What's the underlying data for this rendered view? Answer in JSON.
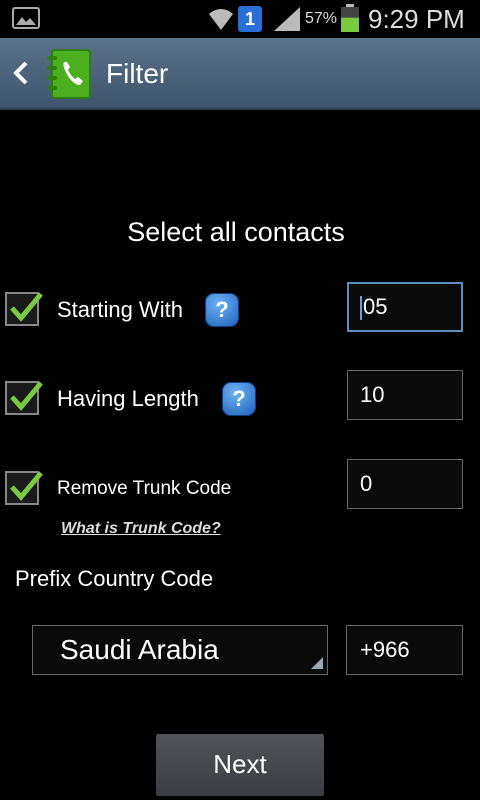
{
  "status_bar": {
    "notification_count": "1",
    "battery_percent": "57%",
    "battery_level": 0.57,
    "time": "9:29 PM",
    "icons": [
      "gallery-icon",
      "wifi-icon",
      "signal-icon",
      "battery-icon"
    ]
  },
  "action_bar": {
    "title": "Filter",
    "back_icon": "chevron-left-icon",
    "app_icon": "phone-book-icon"
  },
  "main": {
    "heading": "Select all contacts",
    "options": [
      {
        "label": "Starting With",
        "checked": true,
        "has_help": true,
        "value": "05"
      },
      {
        "label": "Having Length",
        "checked": true,
        "has_help": true,
        "value": "10"
      },
      {
        "label": "Remove Trunk Code",
        "checked": true,
        "has_help": false,
        "value": "0"
      }
    ],
    "help_symbol": "?",
    "trunk_link": "What is Trunk Code?",
    "prefix_label": "Prefix Country Code",
    "country": "Saudi Arabia",
    "country_code": "+966",
    "next_label": "Next"
  },
  "colors": {
    "background": "#000000",
    "action_bar": "#4b6279",
    "check_green": "#7ac943",
    "help_blue": "#2a72cf"
  }
}
